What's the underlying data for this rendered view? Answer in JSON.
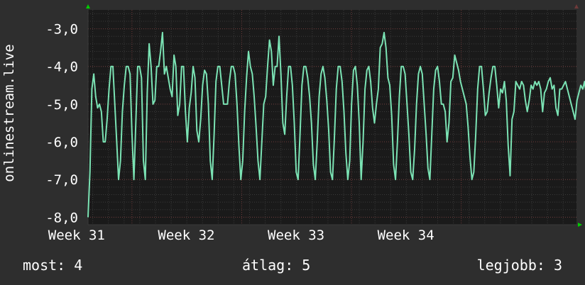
{
  "colors": {
    "background": "#2e2e2e",
    "plot_background": "#1a1a1a",
    "series": "#7be3b4",
    "grid_major": "#6e3a3a",
    "grid_minor": "#3a3a3a",
    "axis_arrow": "#00cc00",
    "text": "#ffffff"
  },
  "footer": {
    "now": "most: 4",
    "avg": "átlag: 5",
    "best": "legjobb: 3"
  },
  "chart_data": {
    "type": "line",
    "ylabel": "onlinestream.live",
    "yticks": [
      "-3,0",
      "-4,0",
      "-5,0",
      "-6,0",
      "-7,0",
      "-8,0"
    ],
    "ytick_values": [
      -3,
      -4,
      -5,
      -6,
      -7,
      -8
    ],
    "ylim": [
      -8.2,
      -2.5
    ],
    "xticks": [
      "Week 31",
      "Week 32",
      "Week 33",
      "Week 34"
    ],
    "xtick_positions": [
      31,
      32,
      33,
      34
    ],
    "xlim": [
      30.6,
      35.05
    ],
    "grid": true,
    "series": [
      {
        "x_start": 30.6,
        "x_step": 0.0174,
        "values": [
          -8,
          -6.8,
          -4.6,
          -4.2,
          -4.8,
          -5.1,
          -5,
          -5.2,
          -6,
          -6,
          -5.4,
          -4.6,
          -4,
          -4,
          -5,
          -6,
          -7,
          -6.5,
          -5.2,
          -4.5,
          -4,
          -4,
          -4.2,
          -5.8,
          -7,
          -5.5,
          -4,
          -4,
          -4.3,
          -6.5,
          -7,
          -4.7,
          -3.4,
          -4,
          -5,
          -4.9,
          -4,
          -4,
          -3.6,
          -3.1,
          -4.2,
          -4,
          -4.3,
          -4.6,
          -4.8,
          -3.7,
          -4,
          -5.3,
          -5,
          -4,
          -4,
          -5.2,
          -6,
          -5.1,
          -4.7,
          -4,
          -4.3,
          -5.7,
          -6,
          -5.4,
          -4.5,
          -4.1,
          -4.2,
          -5,
          -6.5,
          -7,
          -5.8,
          -4.4,
          -4,
          -4,
          -4.5,
          -5,
          -5,
          -5,
          -4.4,
          -4,
          -4,
          -4.2,
          -5,
          -6.1,
          -7,
          -6.5,
          -5.2,
          -4.3,
          -3.6,
          -4,
          -4.2,
          -4.8,
          -5.6,
          -6.5,
          -7,
          -6,
          -5,
          -4.8,
          -4,
          -3.3,
          -3.6,
          -4.5,
          -4,
          -4,
          -3.2,
          -4.2,
          -5.5,
          -5.8,
          -4.8,
          -4,
          -4,
          -4.5,
          -5.5,
          -6.8,
          -7,
          -5.8,
          -4.5,
          -4,
          -4,
          -4.3,
          -4.8,
          -5.5,
          -6.6,
          -7,
          -6,
          -4.8,
          -4.2,
          -4,
          -4.3,
          -4.9,
          -5.7,
          -6.8,
          -7,
          -5.9,
          -4.6,
          -4,
          -4,
          -4.4,
          -5.2,
          -6.3,
          -7,
          -6.5,
          -5,
          -4.1,
          -4,
          -4.5,
          -5.5,
          -7,
          -6,
          -4.6,
          -4.1,
          -4,
          -4.4,
          -5.1,
          -5.5,
          -5,
          -4.6,
          -3.5,
          -3.4,
          -3.1,
          -3.5,
          -4.3,
          -4.5,
          -5.3,
          -6.6,
          -7,
          -6,
          -4.8,
          -4,
          -4,
          -4.2,
          -5,
          -5.8,
          -6.8,
          -7,
          -6.2,
          -5,
          -4.2,
          -4,
          -4.2,
          -5,
          -5.8,
          -6.7,
          -7,
          -5.8,
          -4.6,
          -4.1,
          -4,
          -4.4,
          -5,
          -5,
          -5.2,
          -6,
          -5.5,
          -4.4,
          -4.3,
          -3.7,
          -3.9,
          -4.1,
          -4.4,
          -4.6,
          -4.8,
          -5,
          -5.6,
          -6.4,
          -7,
          -6.8,
          -5.8,
          -4.6,
          -4,
          -4,
          -4.6,
          -5.3,
          -5.2,
          -4.7,
          -4.3,
          -4,
          -4,
          -4.5,
          -5.1,
          -4.6,
          -4.7,
          -4.4,
          -4.9,
          -6.1,
          -6.9,
          -5.4,
          -5.2,
          -4.4,
          -4.5,
          -4.6,
          -4.4,
          -4.5,
          -4.9,
          -5.2,
          -4.9,
          -4.5,
          -4.6,
          -4.4,
          -4.5,
          -4.4,
          -4.6,
          -5.2,
          -4.7,
          -4.6,
          -4.4,
          -4.3,
          -4.6,
          -4.5,
          -5.1,
          -5.3,
          -4.6,
          -4.6,
          -4.5,
          -4.4,
          -4.6,
          -4.8,
          -5,
          -5.2,
          -5.4,
          -4.9,
          -4.7,
          -4.5,
          -4.6,
          -4.4,
          -4.8,
          -5.3,
          -5,
          -4.7,
          -4.6,
          -4.5,
          -4.6,
          -4.6,
          -5,
          -4.8,
          -4.5,
          -4.6,
          -4.5,
          -4.7,
          -5.2,
          -4.6,
          -4.5,
          -4.6,
          -4.4,
          -4.5
        ]
      }
    ]
  }
}
